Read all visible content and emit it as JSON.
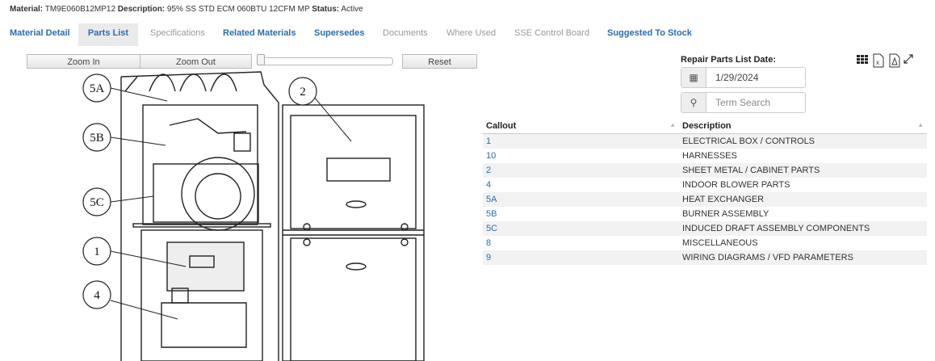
{
  "header": {
    "material_label": "Material:",
    "material_value": "TM9E060B12MP12",
    "description_label": "Description:",
    "description_value": "95% SS STD ECM 060BTU 12CFM MP",
    "status_label": "Status:",
    "status_value": "Active"
  },
  "tabs": [
    {
      "label": "Material Detail"
    },
    {
      "label": "Parts List"
    },
    {
      "label": "Specifications"
    },
    {
      "label": "Related Materials"
    },
    {
      "label": "Supersedes"
    },
    {
      "label": "Documents"
    },
    {
      "label": "Where Used"
    },
    {
      "label": "SSE Control Board"
    },
    {
      "label": "Suggested To Stock"
    }
  ],
  "zoom": {
    "zoom_in": "Zoom In",
    "zoom_out": "Zoom Out",
    "reset": "Reset"
  },
  "diagram": {
    "callouts": [
      "5A",
      "5B",
      "5C",
      "1",
      "4",
      "2"
    ]
  },
  "repair": {
    "label": "Repair Parts List Date:",
    "date": "1/29/2024",
    "search_placeholder": "Term Search",
    "icons": [
      "grid-icon",
      "excel-export-icon",
      "pdf-export-icon",
      "expand-icon"
    ]
  },
  "table": {
    "columns": [
      "Callout",
      "Description"
    ],
    "rows": [
      {
        "callout": "1",
        "description": "ELECTRICAL BOX / CONTROLS"
      },
      {
        "callout": "10",
        "description": "HARNESSES"
      },
      {
        "callout": "2",
        "description": "SHEET METAL / CABINET PARTS"
      },
      {
        "callout": "4",
        "description": "INDOOR BLOWER PARTS"
      },
      {
        "callout": "5A",
        "description": "HEAT EXCHANGER"
      },
      {
        "callout": "5B",
        "description": "BURNER ASSEMBLY"
      },
      {
        "callout": "5C",
        "description": "INDUCED DRAFT ASSEMBLY COMPONENTS"
      },
      {
        "callout": "8",
        "description": "MISCELLANEOUS"
      },
      {
        "callout": "9",
        "description": "WIRING DIAGRAMS / VFD PARAMETERS"
      }
    ]
  },
  "colors": {
    "link": "#2a6db0",
    "disabled": "#999999",
    "active_tab_bg": "#eaeaea"
  }
}
